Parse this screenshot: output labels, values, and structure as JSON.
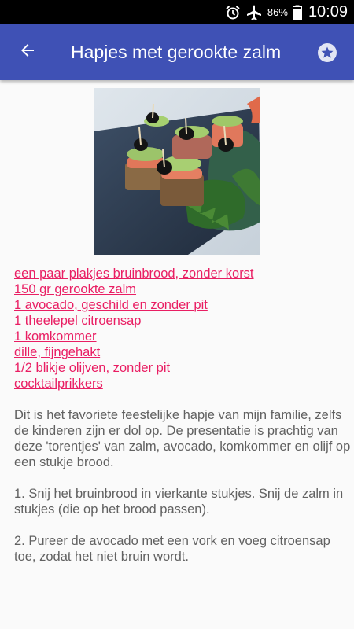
{
  "status_bar": {
    "battery_pct": "86%",
    "time": "10:09",
    "icons": [
      "alarm-icon",
      "airplane-icon",
      "battery-icon"
    ]
  },
  "app_bar": {
    "title": "Hapjes met gerookte zalm",
    "back_icon": "arrow-left-icon",
    "favorite_icon": "star-icon",
    "color": "#3f51b5"
  },
  "recipe": {
    "ingredients": [
      "een paar plakjes bruinbrood, zonder korst",
      "150 gr gerookte zalm",
      "1 avocado, geschild en zonder pit",
      "1 theelepel citroensap",
      "1 komkommer",
      "dille, fijngehakt",
      "1/2 blikje olijven, zonder pit",
      "cocktailprikkers"
    ],
    "paragraphs": [
      "Dit is het favoriete feestelijke hapje van mijn familie, zelfs de kinderen zijn er dol op. De presentatie is prachtig van deze 'torentjes' van zalm, avocado, komkommer en olijf op een stukje brood.",
      "1. Snij het bruinbrood in vierkante stukjes. Snij de zalm in stukjes (die op het brood passen).",
      "2. Pureer de avocado met een vork en voeg citroensap toe, zodat het niet bruin wordt."
    ],
    "link_color": "#e91e63"
  }
}
